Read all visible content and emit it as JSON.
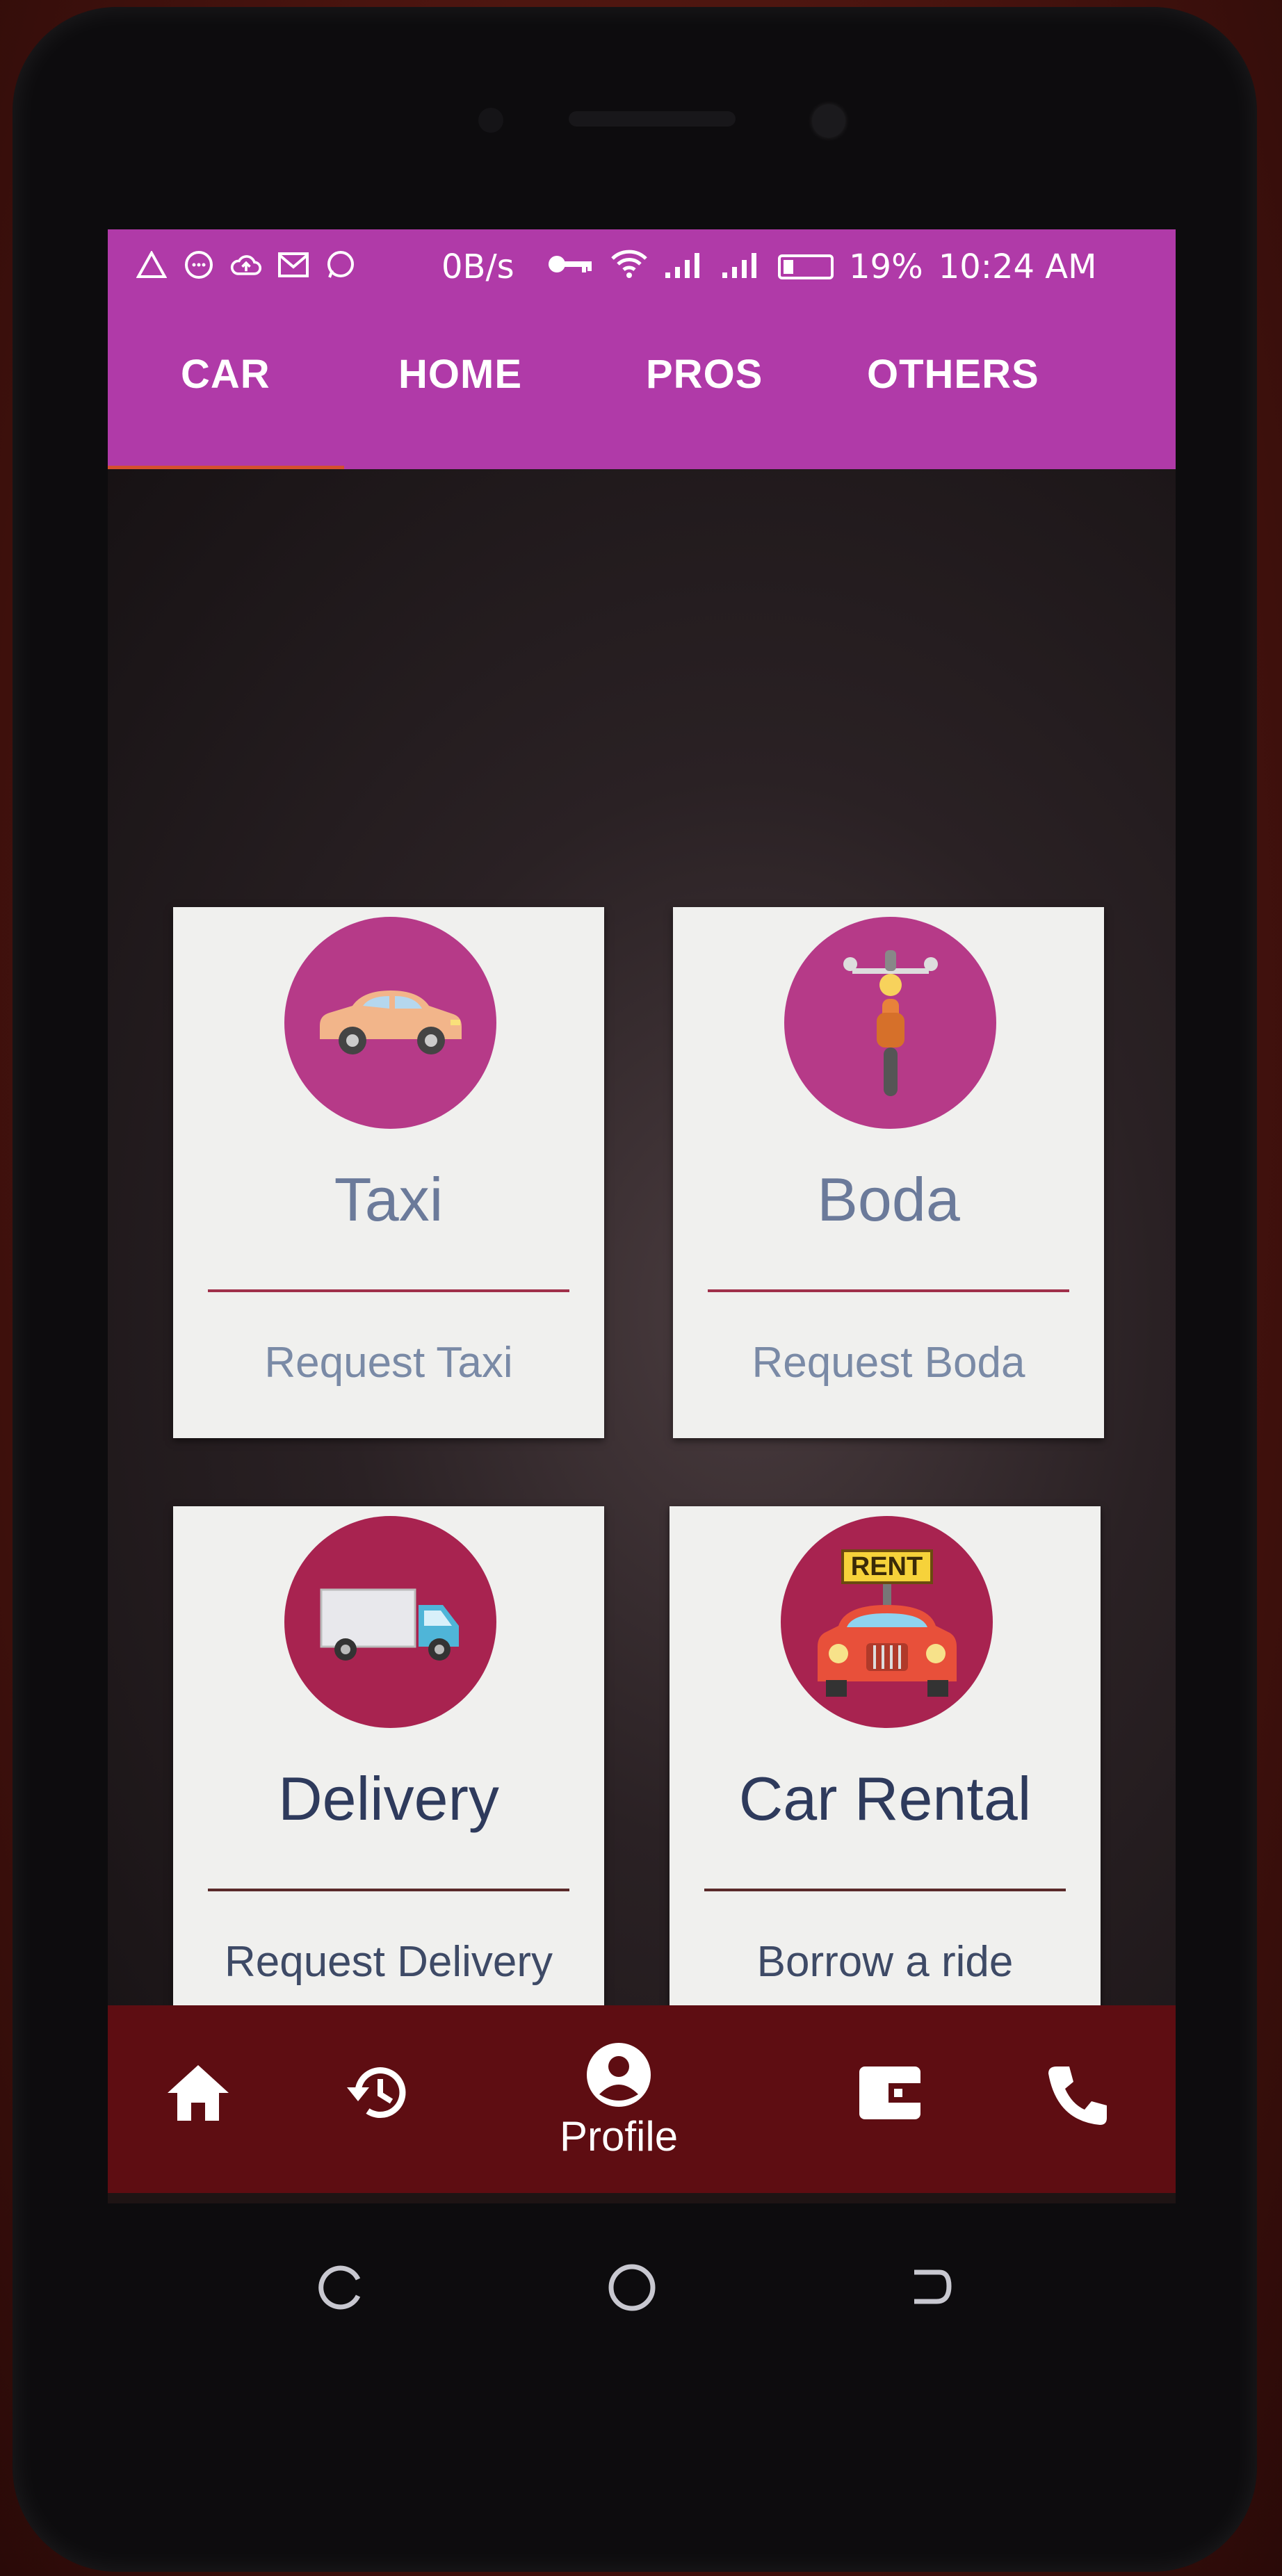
{
  "status_bar": {
    "speed": "0B/s",
    "battery": "19%",
    "time": "10:24 AM"
  },
  "tabs": [
    {
      "label": "CAR"
    },
    {
      "label": "HOME"
    },
    {
      "label": "PROS"
    },
    {
      "label": "OTHERS"
    }
  ],
  "cards": [
    {
      "title": "Taxi",
      "subtitle": "Request Taxi",
      "icon": "car-icon"
    },
    {
      "title": "Boda",
      "subtitle": "Request Boda",
      "icon": "motorbike-icon"
    },
    {
      "title": "Delivery",
      "subtitle": "Request Delivery",
      "icon": "truck-icon"
    },
    {
      "title": "Car Rental",
      "subtitle": "Borrow a ride",
      "icon": "rent-car-icon",
      "badge": "RENT"
    }
  ],
  "bottom_nav": {
    "profile_label": "Profile",
    "items": [
      "home-icon",
      "history-icon",
      "profile-icon",
      "wallet-icon",
      "phone-icon"
    ]
  },
  "colors": {
    "accent": "#b03aa8",
    "circle": "#b63a88",
    "bottom_nav": "#5e0d12",
    "tab_indicator": "#d4502e"
  }
}
